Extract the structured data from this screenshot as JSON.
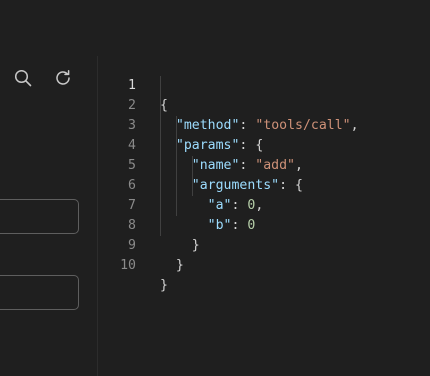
{
  "left_panel": {
    "icons": {
      "search": "search-icon",
      "refresh": "refresh-icon"
    },
    "fields": [
      {
        "value": "",
        "placeholder": ""
      },
      {
        "value": "",
        "placeholder": ""
      }
    ]
  },
  "editor": {
    "line_numbers": [
      "1",
      "2",
      "3",
      "4",
      "5",
      "6",
      "7",
      "8",
      "9",
      "10"
    ],
    "tokens": {
      "open_brace": "{",
      "close_brace": "}",
      "method_key": "\"method\"",
      "method_value": "\"tools/call\"",
      "params_key": "\"params\"",
      "name_key": "\"name\"",
      "name_value": "\"add\"",
      "arguments_key": "\"arguments\"",
      "a_key": "\"a\"",
      "a_value": "0",
      "b_key": "\"b\"",
      "b_value": "0"
    }
  },
  "colors": {
    "background": "#1f1f1f",
    "json_key": "#9cdcfe",
    "json_string": "#ce9178",
    "json_number": "#b5cea8",
    "line_number": "#8a8a8a"
  }
}
